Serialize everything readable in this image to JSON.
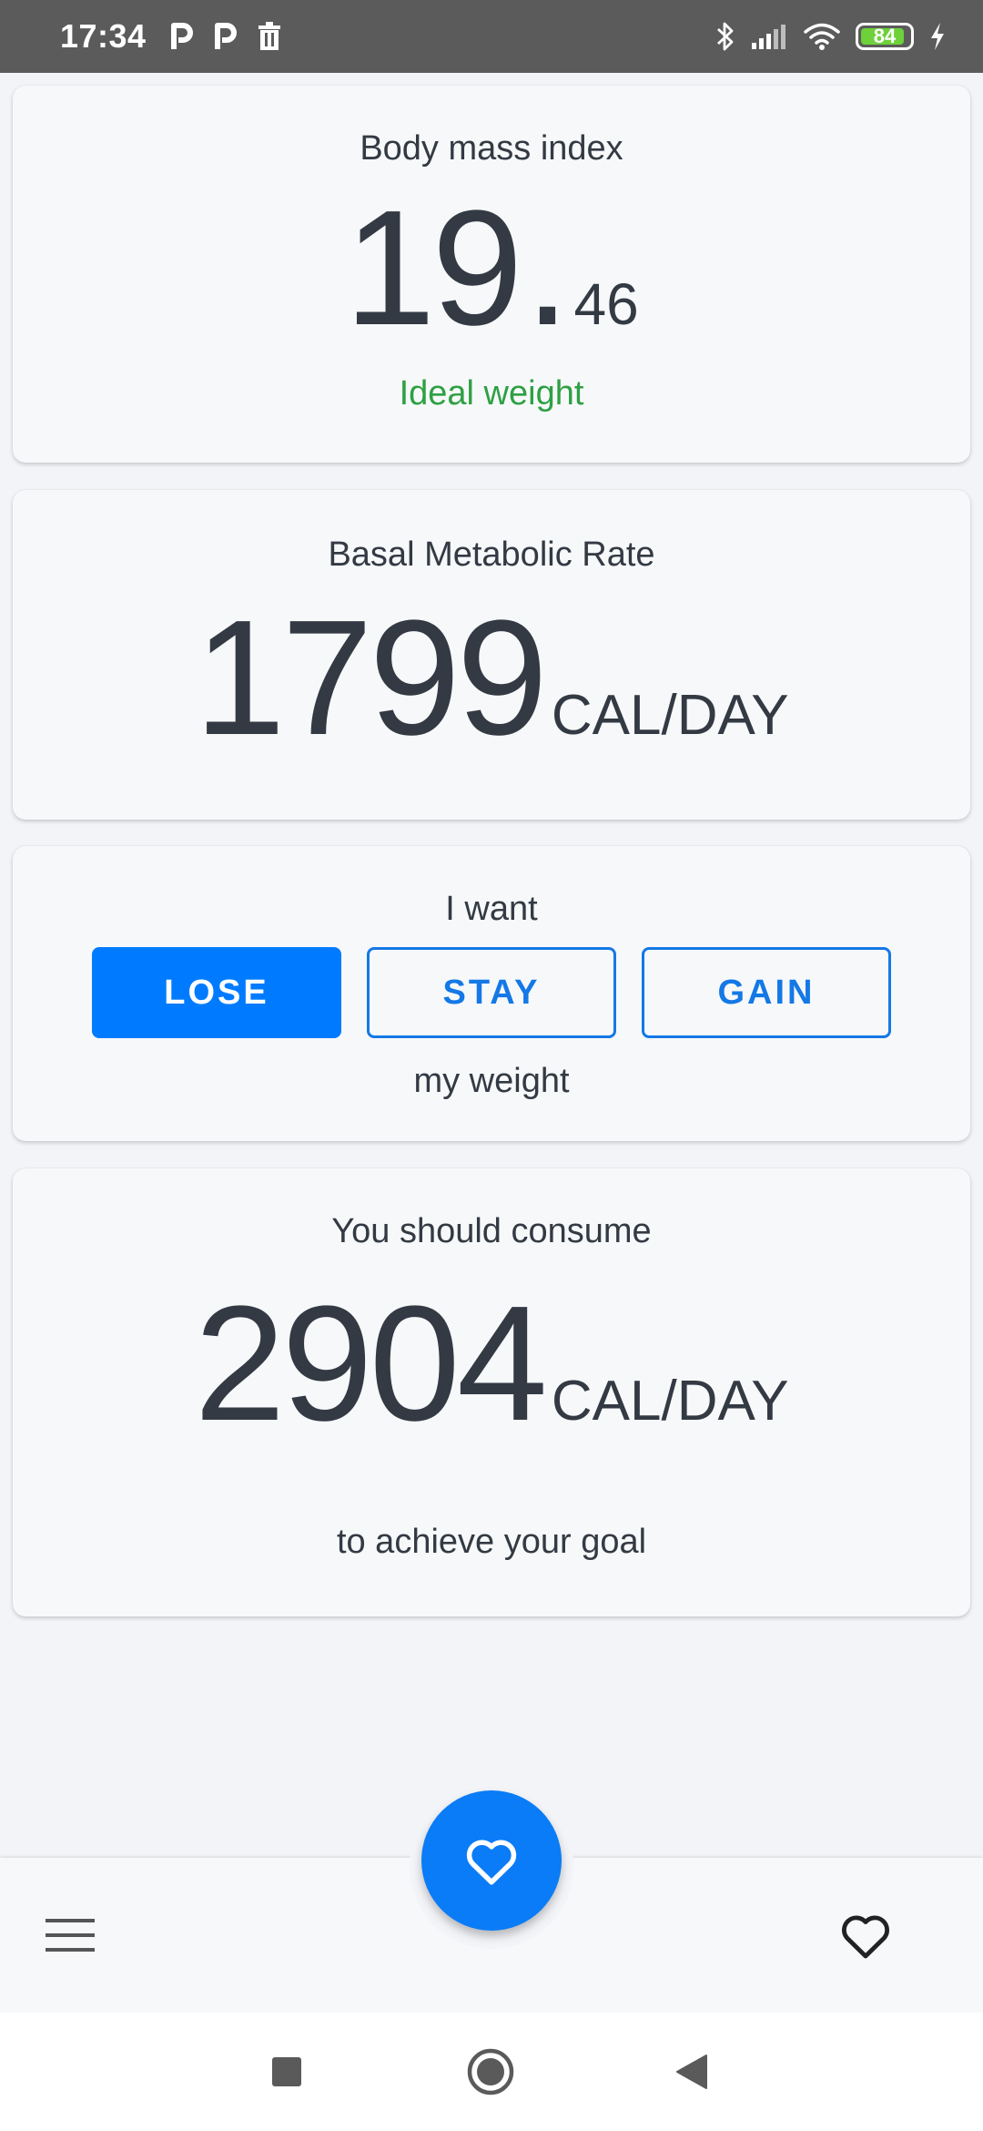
{
  "status_bar": {
    "time": "17:34",
    "left_icons": [
      "parking-icon",
      "parking-icon",
      "trash-icon"
    ],
    "right_icons": [
      "bluetooth-icon",
      "signal-icon",
      "wifi-icon",
      "battery-icon",
      "charging-icon"
    ],
    "battery_level": "84"
  },
  "bmi": {
    "title": "Body mass index",
    "value_int": "19",
    "value_sep": ".",
    "value_dec": "46",
    "status": "Ideal weight",
    "status_color": "#2ea043"
  },
  "bmr": {
    "title": "Basal Metabolic Rate",
    "value": "1799",
    "unit": "CAL/DAY"
  },
  "goal": {
    "title": "I want",
    "buttons": [
      {
        "label": "LOSE",
        "active": true
      },
      {
        "label": "STAY",
        "active": false
      },
      {
        "label": "GAIN",
        "active": false
      }
    ],
    "suffix": "my weight",
    "accent": "#007bff"
  },
  "consume": {
    "title": "You should consume",
    "value": "2904",
    "unit": "CAL/DAY",
    "caption": "to achieve your goal"
  },
  "bottom_bar": {
    "left_icon": "menu-icon",
    "fab_icon": "heart-icon",
    "right_icon": "heart-outline-icon"
  },
  "nav_bar": {
    "icons": [
      "recents-icon",
      "home-icon",
      "back-icon"
    ]
  }
}
